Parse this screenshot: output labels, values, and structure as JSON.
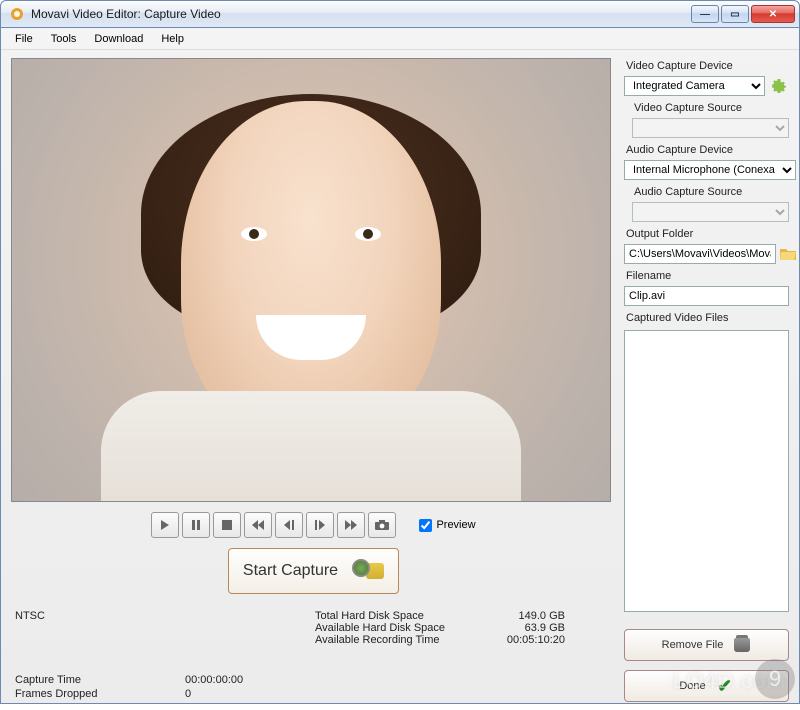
{
  "window": {
    "title": "Movavi Video Editor: Capture Video"
  },
  "menubar": [
    "File",
    "Tools",
    "Download",
    "Help"
  ],
  "preview_checkbox_label": "Preview",
  "start_capture_label": "Start Capture",
  "right_panel": {
    "video_device_label": "Video Capture Device",
    "video_device_value": "Integrated Camera",
    "video_source_label": "Video Capture Source",
    "video_source_value": "",
    "audio_device_label": "Audio Capture Device",
    "audio_device_value": "Internal Microphone (Conexa",
    "audio_source_label": "Audio Capture Source",
    "audio_source_value": "",
    "output_folder_label": "Output Folder",
    "output_folder_value": "C:\\Users\\Movavi\\Videos\\Movavi",
    "filename_label": "Filename",
    "filename_value": "Clip.avi",
    "captured_files_label": "Captured Video Files",
    "remove_file_label": "Remove File",
    "done_label": "Done"
  },
  "status": {
    "ntsc_label": "NTSC",
    "total_disk_label": "Total Hard Disk Space",
    "total_disk_value": "149.0 GB",
    "avail_disk_label": "Available Hard Disk Space",
    "avail_disk_value": "63.9 GB",
    "avail_rec_label": "Available Recording Time",
    "avail_rec_value": "00:05:10:20",
    "capture_time_label": "Capture Time",
    "capture_time_value": "00:00:00:00",
    "frames_dropped_label": "Frames Dropped",
    "frames_dropped_value": "0"
  },
  "watermark": "LO4D.com",
  "badge": "9"
}
